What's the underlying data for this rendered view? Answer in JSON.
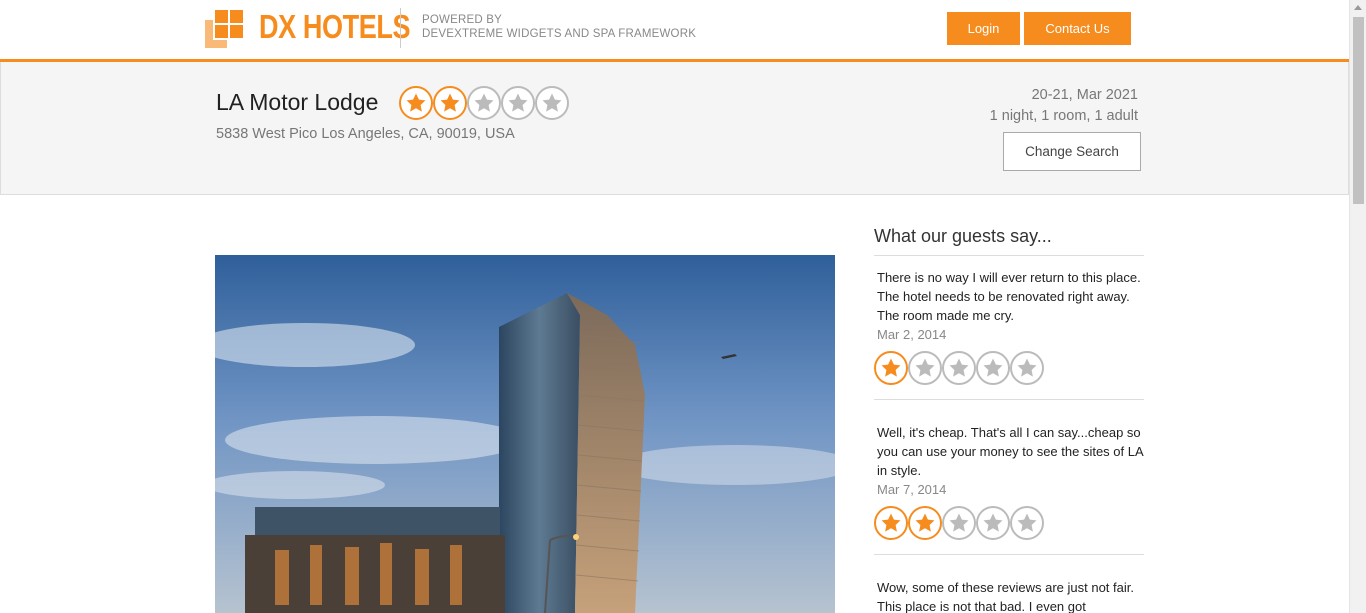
{
  "header": {
    "brand": "DX HOTELS",
    "powered_line1": "POWERED BY",
    "powered_line2": "DEVEXTREME WIDGETS AND SPA FRAMEWORK",
    "login_label": "Login",
    "contact_label": "Contact Us"
  },
  "hotel": {
    "name": "LA Motor Lodge",
    "rating": 2,
    "max_rating": 5,
    "address": "5838 West Pico Los Angeles, CA, 90019, USA"
  },
  "search": {
    "dates": "20-21, Mar 2021",
    "summary": "1 night, 1 room, 1 adult",
    "change_label": "Change Search"
  },
  "reviews": {
    "title": "What our guests say...",
    "items": [
      {
        "text": "There is no way I will ever return to this place. The hotel needs to be renovated right away. The room made me cry.",
        "date": "Mar 2, 2014",
        "rating": 1
      },
      {
        "text": "Well, it's cheap. That's all I can say...cheap so you can use your money to see the sites of LA in style.",
        "date": "Mar 7, 2014",
        "rating": 2
      },
      {
        "text": "Wow, some of these reviews are just not fair. This place is not that bad. I even got",
        "date": "",
        "rating": 0
      }
    ]
  },
  "colors": {
    "accent": "#f68c1e",
    "star_off": "#bbbbbb"
  },
  "icons": {
    "logo": "dx-hotels-logo-icon",
    "star": "star-icon"
  }
}
